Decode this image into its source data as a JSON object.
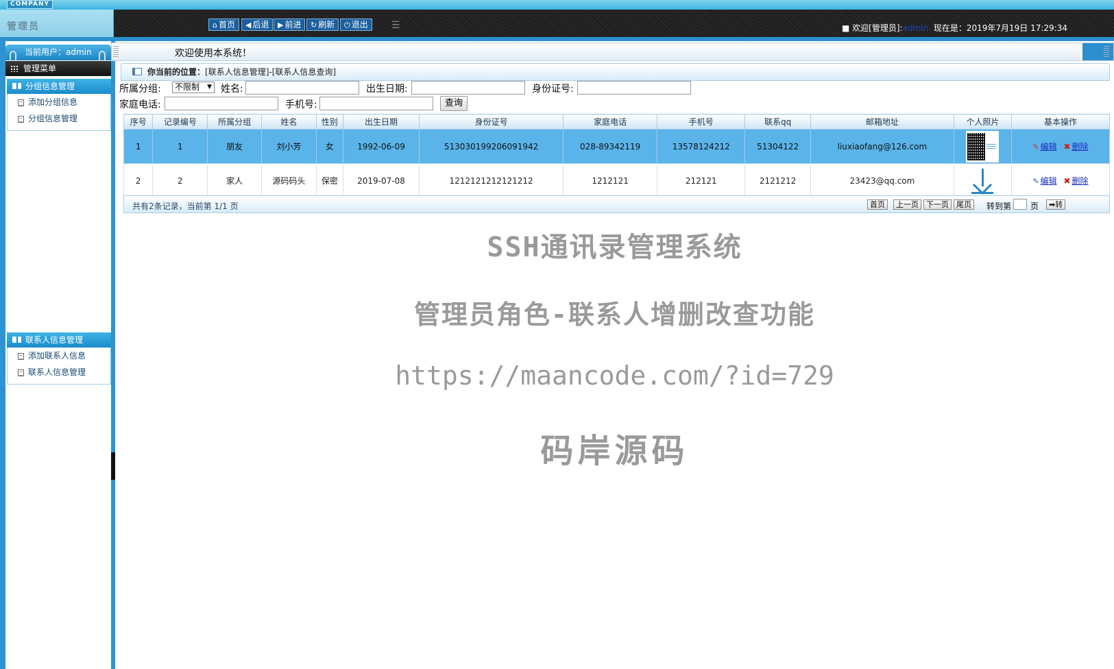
{
  "header": {
    "company": "COMPANY",
    "role": "管理员",
    "nav": [
      {
        "label": "首页",
        "icon": "home-icon"
      },
      {
        "label": "后退",
        "icon": "arrow-left-icon"
      },
      {
        "label": "前进",
        "icon": "arrow-right-icon"
      },
      {
        "label": "刷新",
        "icon": "refresh-icon"
      },
      {
        "label": "退出",
        "icon": "power-icon"
      }
    ],
    "welcome_prefix": "欢迎[管理员]:",
    "welcome_user": "admin",
    "now_label": "现在是：2019年7月19日 17:29:34"
  },
  "sidebar": {
    "current_user": "当前用户：admin",
    "menu_title": "管理菜单",
    "groups": [
      {
        "title": "分组信息管理",
        "items": [
          "添加分组信息",
          "分组信息管理"
        ]
      },
      {
        "title": "联系人信息管理",
        "items": [
          "添加联系人信息",
          "联系人信息管理"
        ]
      }
    ]
  },
  "main": {
    "welcome": "欢迎使用本系统！",
    "breadcrumb_label": "你当前的位置：",
    "breadcrumb_path": "[联系人信息管理]-[联系人信息查询]"
  },
  "search": {
    "group_label": "所属分组:",
    "group_value": "不限制",
    "name_label": "姓名:",
    "birth_label": "出生日期:",
    "idcard_label": "身份证号:",
    "homephone_label": "家庭电话:",
    "mobile_label": "手机号:",
    "query_button": "查询"
  },
  "table": {
    "columns": [
      "序号",
      "记录编号",
      "所属分组",
      "姓名",
      "性别",
      "出生日期",
      "身份证号",
      "家庭电话",
      "手机号",
      "联系qq",
      "邮箱地址",
      "个人照片",
      "基本操作"
    ],
    "rows": [
      {
        "seq": "1",
        "id": "1",
        "group": "朋友",
        "name": "刘小芳",
        "gender": "女",
        "birth": "1992-06-09",
        "idcard": "513030199206091942",
        "home": "028-89342119",
        "mobile": "13578124212",
        "qq": "51304122",
        "email": "liuxiaofang@126.com",
        "photo": "qr-code-image"
      },
      {
        "seq": "2",
        "id": "2",
        "group": "家人",
        "name": "源码码头",
        "gender": "保密",
        "birth": "2019-07-08",
        "idcard": "1212121212121212",
        "home": "1212121",
        "mobile": "212121",
        "qq": "2121212",
        "email": "23423@qq.com",
        "photo": "download-icon"
      }
    ],
    "edit_label": "编辑",
    "delete_label": "删除"
  },
  "pager": {
    "info": "共有2条记录，当前第 1/1 页",
    "first": "首页",
    "prev": "上一页",
    "next": "下一页",
    "last": "尾页",
    "goto_label": "转到第",
    "page_unit": "页",
    "go_button": "➡转"
  },
  "watermark": {
    "line1": "SSH通讯录管理系统",
    "line2": "管理员角色-联系人增删改查功能",
    "line3": "https://maancode.com/?id=729",
    "line4": "码岸源码"
  }
}
